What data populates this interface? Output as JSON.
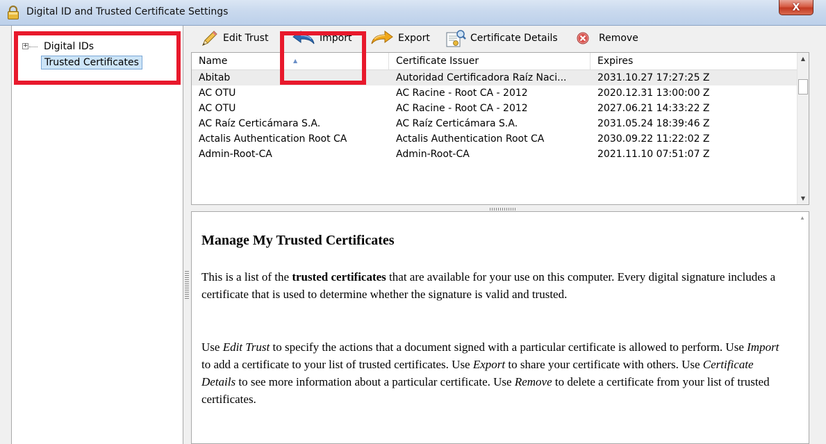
{
  "window": {
    "title": "Digital ID and Trusted Certificate Settings",
    "close_label": "X"
  },
  "tree": {
    "items": [
      {
        "label": "Digital IDs",
        "expander": "+"
      },
      {
        "label": "Trusted Certificates",
        "selected": true
      }
    ]
  },
  "toolbar": {
    "edit_trust": "Edit Trust",
    "import": "Import",
    "export": "Export",
    "certificate_details": "Certificate Details",
    "remove": "Remove"
  },
  "table": {
    "columns": [
      "Name",
      "Certificate Issuer",
      "Expires"
    ],
    "rows": [
      {
        "name": "Abitab",
        "issuer": "Autoridad Certificadora Raíz Naci...",
        "expires": "2031.10.27 17:27:25 Z"
      },
      {
        "name": "AC OTU",
        "issuer": "AC Racine - Root CA - 2012",
        "expires": "2020.12.31 13:00:00 Z"
      },
      {
        "name": "AC OTU",
        "issuer": "AC Racine - Root CA - 2012",
        "expires": "2027.06.21 14:33:22 Z"
      },
      {
        "name": "AC Raíz Certicámara S.A.",
        "issuer": "AC Raíz Certicámara S.A.",
        "expires": "2031.05.24 18:39:46 Z"
      },
      {
        "name": "Actalis Authentication Root CA",
        "issuer": "Actalis Authentication Root CA",
        "expires": "2030.09.22 11:22:02 Z"
      },
      {
        "name": "Admin-Root-CA",
        "issuer": "Admin-Root-CA",
        "expires": "2021.11.10 07:51:07 Z"
      }
    ]
  },
  "description": {
    "heading": "Manage My Trusted Certificates",
    "p1_a": "This is a list of the ",
    "p1_bold": "trusted certificates",
    "p1_b": " that are available for your use on this computer. Every digital signature includes a certificate that is used to determine whether the signature is valid and trusted.",
    "p2_1": "Use ",
    "p2_edit": "Edit Trust",
    "p2_2": " to specify the actions that a document signed with a particular certificate is allowed to perform. Use ",
    "p2_import": "Import",
    "p2_3": " to add a certificate to your list of trusted certificates. Use ",
    "p2_export": "Export",
    "p2_4": " to share your certificate with others. Use ",
    "p2_details": "Certificate Details",
    "p2_5": " to see more information about a particular certificate. Use ",
    "p2_remove": "Remove",
    "p2_6": " to delete a certificate from your list of trusted certificates."
  },
  "colors": {
    "highlight": "#e8192c",
    "selection": "#cce4f7",
    "remove_icon": "#d9534f"
  },
  "icons": [
    "lock-icon",
    "pencil-icon",
    "import-arrow-icon",
    "export-arrow-icon",
    "certificate-details-icon",
    "remove-icon"
  ]
}
